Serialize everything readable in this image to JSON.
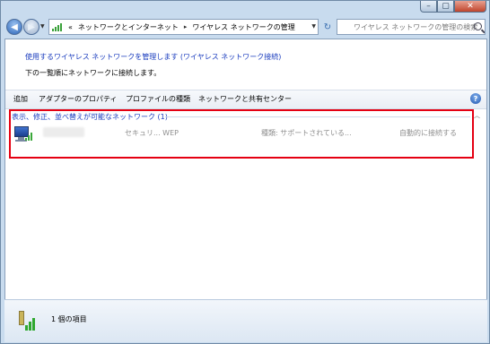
{
  "window": {
    "minimize_glyph": "–",
    "maximize_glyph": "▢",
    "close_glyph": "✕"
  },
  "navigation": {
    "back_glyph": "◀",
    "forward_glyph": "▶",
    "address": {
      "overflow": "«",
      "crumbs": [
        "ネットワークとインターネット",
        "ワイヤレス ネットワークの管理"
      ],
      "separator": "▸"
    },
    "refresh_glyph": "↻",
    "search_placeholder": "ワイヤレス ネットワークの管理の検索"
  },
  "intro": {
    "link": "使用するワイヤレス ネットワークを管理します (ワイヤレス ネットワーク接続)",
    "text": "下の一覧順にネットワークに接続します。"
  },
  "toolbar": {
    "items": [
      "追加",
      "アダプターのプロパティ",
      "プロファイルの種類",
      "ネットワークと共有センター"
    ],
    "help_glyph": "?"
  },
  "group": {
    "title": "表示、修正、並べ替えが可能なネットワーク (1)",
    "collapse_glyph": "︿"
  },
  "networks": [
    {
      "security": "セキュリ... WEP",
      "type": "種類: サポートされている...",
      "mode": "自動的に接続する"
    }
  ],
  "status": {
    "item_count": "1 個の項目"
  },
  "colors": {
    "highlight": "#e50012",
    "link": "#1a3cbe"
  }
}
